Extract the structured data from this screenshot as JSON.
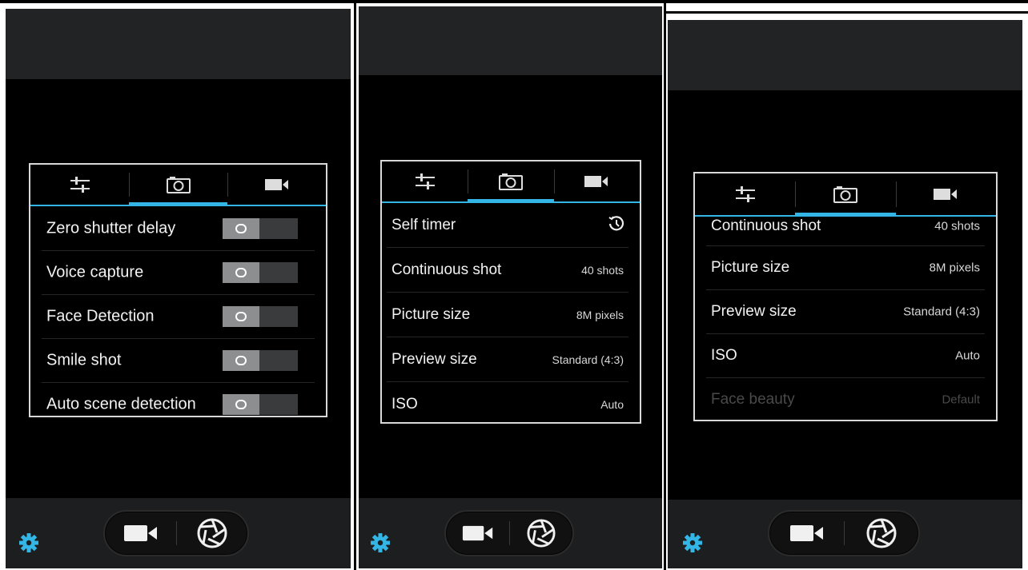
{
  "colors": {
    "accent": "#33b5e5",
    "gear": "#33b5e5",
    "panel_border": "#d8d8d8"
  },
  "icons": {
    "tab_settings": "sliders-icon",
    "tab_camera": "camera-icon",
    "tab_video": "video-icon",
    "self_timer": "timer-icon",
    "bottom_video": "video-camera-icon",
    "bottom_shutter": "aperture-icon",
    "bottom_settings": "gear-icon"
  },
  "screens": [
    {
      "active_tab": 1,
      "rows": [
        {
          "label": "Zero shutter delay",
          "toggle_on": false
        },
        {
          "label": "Voice capture",
          "toggle_on": false
        },
        {
          "label": "Face Detection",
          "toggle_on": false
        },
        {
          "label": "Smile shot",
          "toggle_on": false
        },
        {
          "label": "Auto scene detection",
          "toggle_on": false
        }
      ]
    },
    {
      "active_tab": 1,
      "rows": [
        {
          "label": "Self timer",
          "value": ""
        },
        {
          "label": "Continuous shot",
          "value": "40 shots"
        },
        {
          "label": "Picture size",
          "value": "8M pixels"
        },
        {
          "label": "Preview size",
          "value": "Standard (4:3)"
        },
        {
          "label": "ISO",
          "value": "Auto"
        }
      ]
    },
    {
      "active_tab": 1,
      "rows": [
        {
          "label": "Continuous shot",
          "value": "40 shots"
        },
        {
          "label": "Picture size",
          "value": "8M pixels"
        },
        {
          "label": "Preview size",
          "value": "Standard (4:3)"
        },
        {
          "label": "ISO",
          "value": "Auto"
        },
        {
          "label": "Face beauty",
          "value": "Default"
        }
      ]
    }
  ]
}
